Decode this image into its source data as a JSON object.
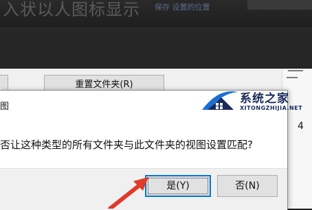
{
  "background": {
    "faded_title": "入状以人图标显示",
    "faded_link": "保存 设置的位置"
  },
  "properties_window": {
    "reset_folders_button": "重置文件夹(R)",
    "right_strip_digit": "4"
  },
  "watermark": {
    "name": "系统之家",
    "url": "XITONGZHIJIA.NET"
  },
  "dialog": {
    "title": "图",
    "message": "否让这种类型的所有文件夹与此文件夹的视图设置匹配?",
    "yes_button": "是(Y)",
    "no_button": "否(N)"
  },
  "colors": {
    "focus_border": "#0078d7",
    "annotation_arrow": "#e03a2a",
    "logo_blue": "#1a6fd6"
  }
}
